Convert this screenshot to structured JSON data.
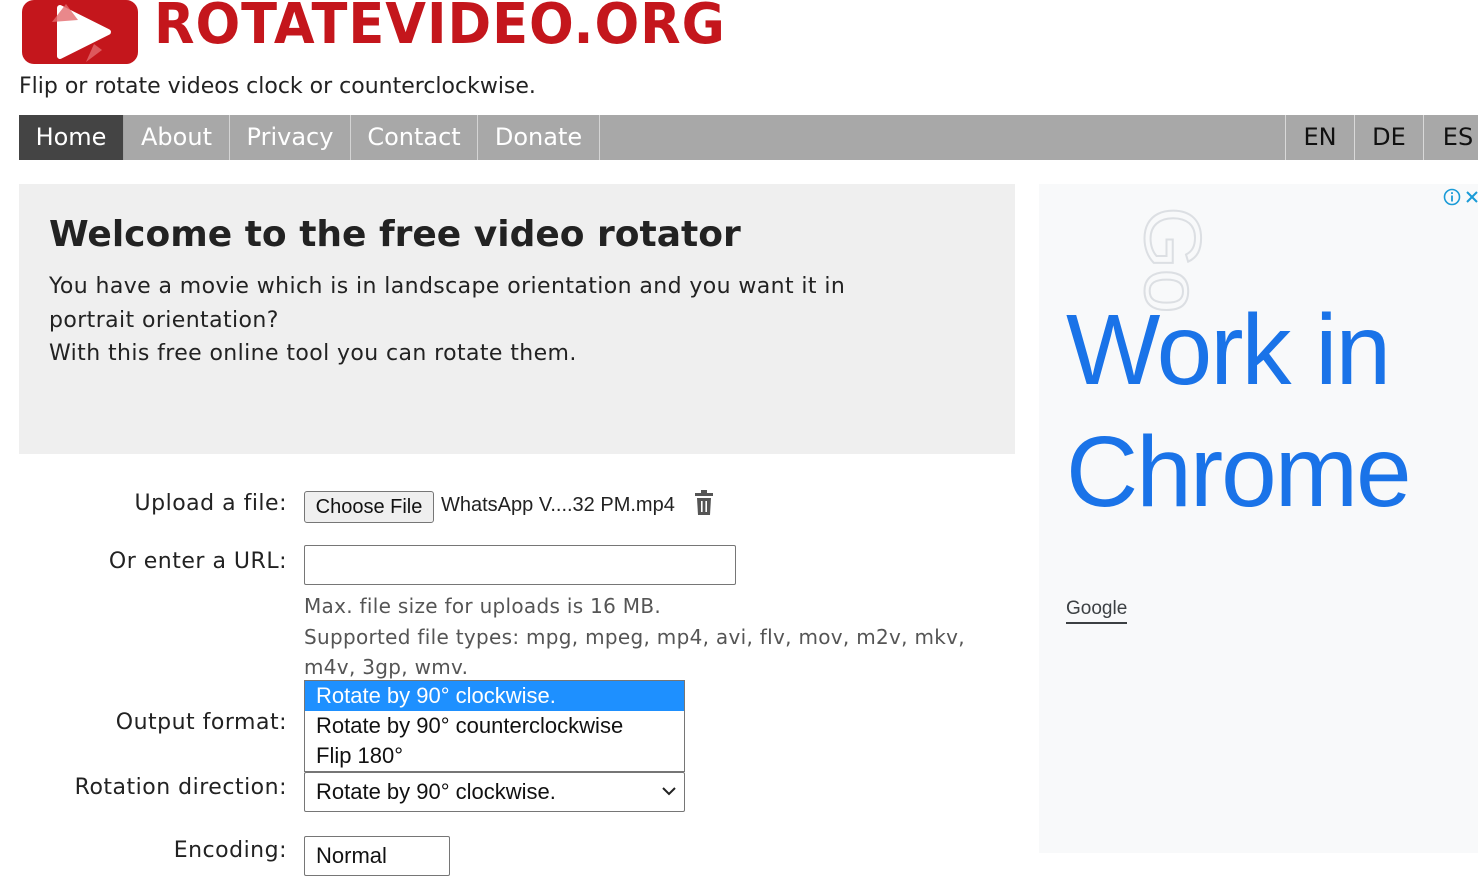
{
  "header": {
    "logo_text": "ROTATEVIDEO.ORG",
    "tagline": "Flip or rotate videos clock or counterclockwise.",
    "brand_color": "#c4161c"
  },
  "nav": {
    "items": [
      {
        "label": "Home",
        "active": true
      },
      {
        "label": "About"
      },
      {
        "label": "Privacy"
      },
      {
        "label": "Contact"
      },
      {
        "label": "Donate"
      }
    ],
    "languages": [
      "EN",
      "DE",
      "ES"
    ]
  },
  "welcome": {
    "title": "Welcome to the free video rotator",
    "line1": "You have a movie which is in landscape orientation and you want it in",
    "line2": "portrait orientation?",
    "line3": "With this free online tool you can rotate them."
  },
  "form": {
    "upload_label": "Upload a file:",
    "choose_file_label": "Choose File",
    "selected_file": "WhatsApp V....32 PM.mp4",
    "url_label": "Or enter a URL:",
    "url_value": "",
    "max_size_text": "Max. file size for uploads is 16 MB.",
    "supported_line1": "Supported file types: mpg, mpeg, mp4, avi, flv, mov, m2v, mkv,",
    "supported_line2": "m4v, 3gp, wmv.",
    "output_format_label": "Output format:",
    "rotation_label": "Rotation direction:",
    "rotation_options": [
      "Rotate by 90° clockwise.",
      "Rotate by 90° counterclockwise",
      "Flip 180°"
    ],
    "rotation_selected": "Rotate by 90° clockwise.",
    "encoding_label": "Encoding:",
    "encoding_selected": "Normal"
  },
  "ad": {
    "headline": "Work in Chrome",
    "brand": "Google",
    "headline_color": "#1a73e8"
  }
}
